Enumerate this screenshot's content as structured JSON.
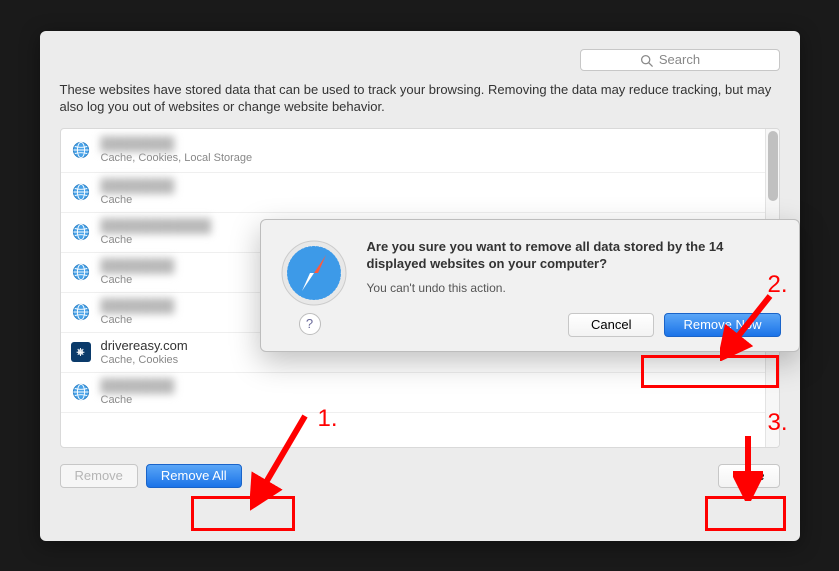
{
  "search": {
    "placeholder": "Search"
  },
  "description": "These websites have stored data that can be used to track your browsing. Removing the data may reduce tracking, but may also log you out of websites or change website behavior.",
  "rows": [
    {
      "domain": "",
      "types": "Cache, Cookies, Local Storage",
      "blurred": true
    },
    {
      "domain": "",
      "types": "Cache",
      "blurred": true
    },
    {
      "domain": "",
      "types": "Cache",
      "blurred": true
    },
    {
      "domain": "",
      "types": "Cache",
      "blurred": true
    },
    {
      "domain": "",
      "types": "Cache",
      "blurred": true
    },
    {
      "domain": "drivereasy.com",
      "types": "Cache, Cookies",
      "blurred": false,
      "icon": "de"
    },
    {
      "domain": "",
      "types": "Cache",
      "blurred": true
    }
  ],
  "buttons": {
    "remove": "Remove",
    "remove_all": "Remove All",
    "done": "Done"
  },
  "dialog": {
    "title": "Are you sure you want to remove all data stored by the 14 displayed websites on your computer?",
    "subtitle": "You can't undo this action.",
    "cancel": "Cancel",
    "confirm": "Remove Now",
    "help": "?"
  },
  "annotations": {
    "one": "1.",
    "two": "2.",
    "three": "3."
  }
}
